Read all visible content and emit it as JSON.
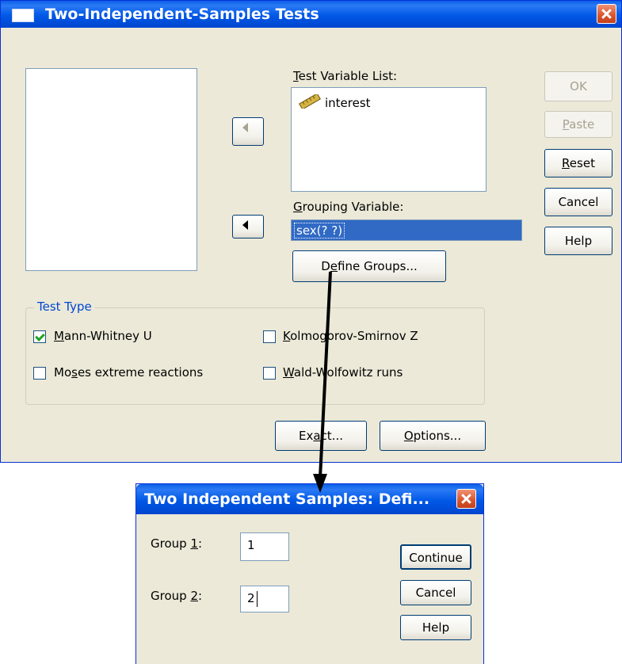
{
  "main_dialog": {
    "title": "Two-Independent-Samples Tests",
    "test_variable_list": {
      "label_u": "T",
      "label_rest": "est Variable List:",
      "items": [
        {
          "name": "interest",
          "icon": "ruler-scale-icon"
        }
      ]
    },
    "grouping_variable": {
      "label_u": "G",
      "label_rest": "rouping Variable:",
      "value": "sex(? ?)"
    },
    "define_groups_button": {
      "pre": "D",
      "u": "e",
      "post": "fine Groups..."
    },
    "test_type": {
      "legend": "Test Type",
      "mann_whitney": {
        "u": "M",
        "post": "ann-Whitney U",
        "checked": true
      },
      "kolmogorov": {
        "u": "K",
        "post": "olmogorov-Smirnov Z",
        "checked": false
      },
      "moses": {
        "pre": "Mo",
        "u": "s",
        "post": "es extreme reactions",
        "checked": false
      },
      "wald": {
        "u": "W",
        "post": "ald-Wolfowitz runs",
        "checked": false
      }
    },
    "buttons": {
      "ok": "OK",
      "paste": {
        "u": "P",
        "post": "aste"
      },
      "reset": {
        "u": "R",
        "post": "eset"
      },
      "cancel": "Cancel",
      "help": "Help",
      "exact": {
        "pre": "Ex",
        "u": "a",
        "post": "ct..."
      },
      "options": {
        "u": "O",
        "post": "ptions..."
      }
    }
  },
  "define_dialog": {
    "title": "Two Independent Samples: Defi...",
    "group1": {
      "pre": "Group ",
      "u": "1",
      "post": ":",
      "value": "1"
    },
    "group2": {
      "pre": "Group ",
      "u": "2",
      "post": ":",
      "value": "2"
    },
    "buttons": {
      "continue": "Continue",
      "cancel": "Cancel",
      "help": "Help"
    }
  },
  "colors": {
    "title_bar": "#0058e6",
    "dialog_bg": "#ece9d8",
    "selection": "#316ac5",
    "close_button": "#d8542c"
  }
}
